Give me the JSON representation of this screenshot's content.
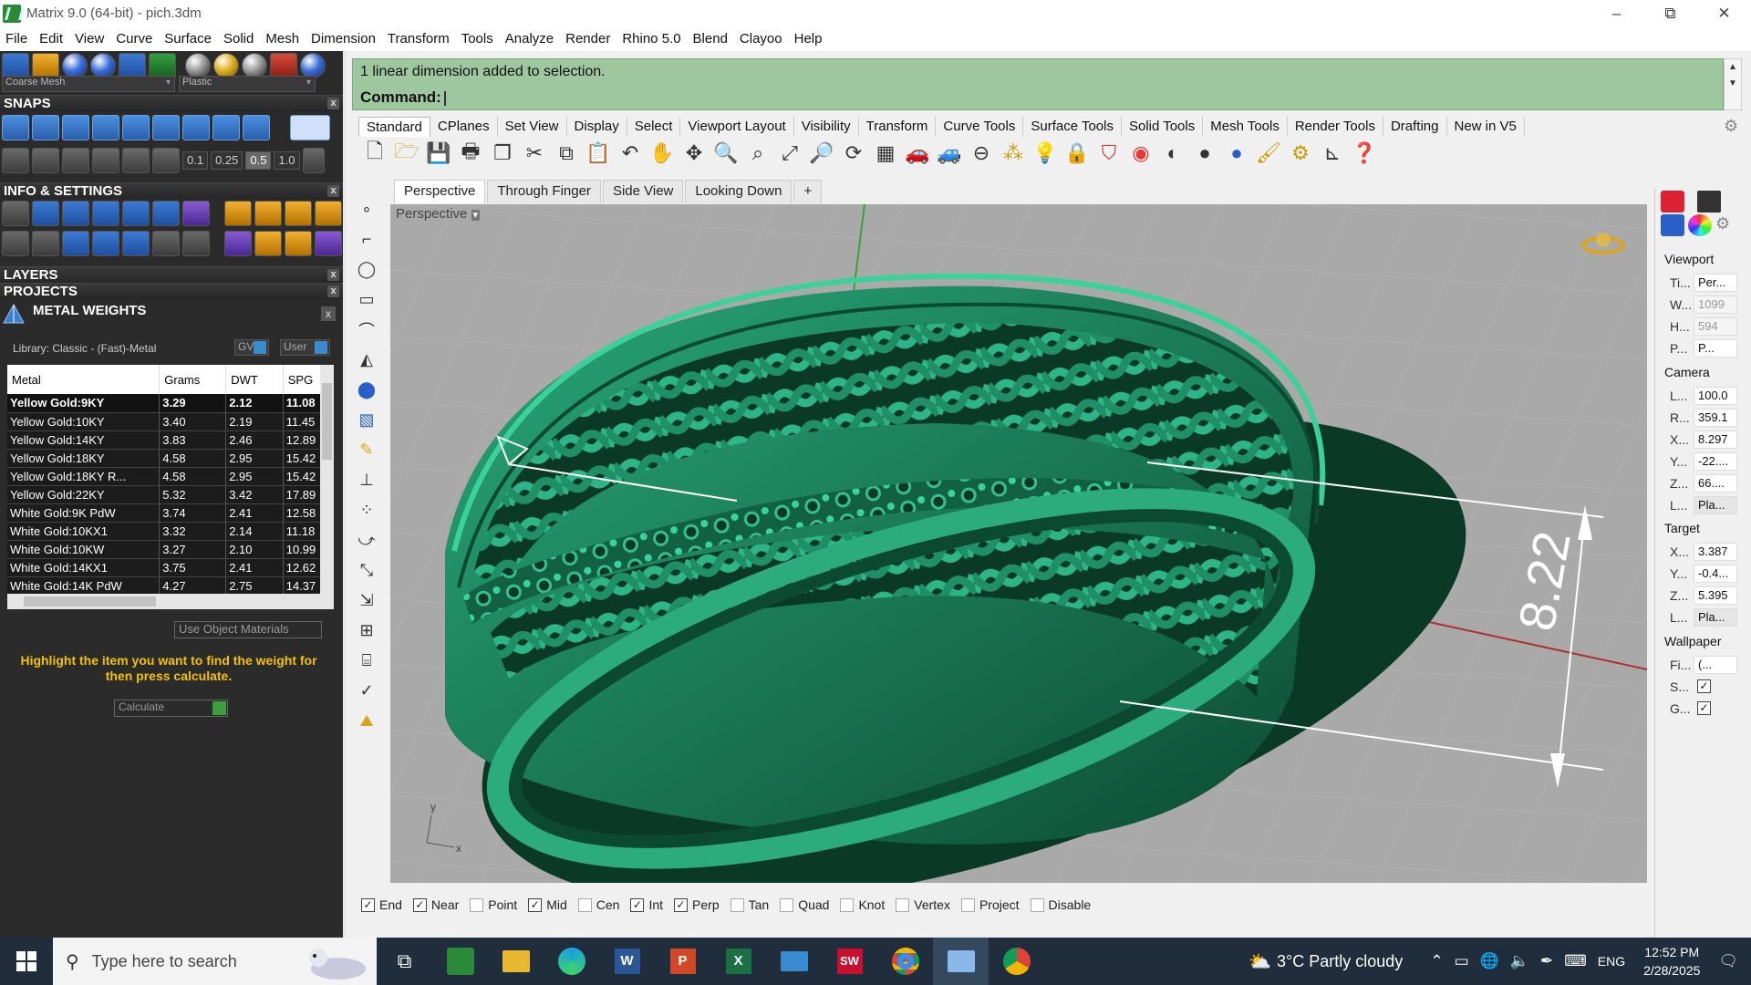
{
  "window": {
    "title": "Matrix 9.0 (64-bit) - pich.3dm"
  },
  "menu": [
    "File",
    "Edit",
    "View",
    "Curve",
    "Surface",
    "Solid",
    "Mesh",
    "Dimension",
    "Transform",
    "Tools",
    "Analyze",
    "Render",
    "Rhino 5.0",
    "Blend",
    "Clayoo",
    "Help"
  ],
  "left_panel": {
    "mesh_combo": "Coarse Mesh",
    "material_combo": "Plastic",
    "snaps_title": "SNAPS",
    "snap_values": [
      "0.1",
      "0.25",
      "0.5",
      "1.0"
    ],
    "info_title": "INFO & SETTINGS",
    "layers_title": "LAYERS",
    "projects_title": "PROJECTS",
    "metal_weights_title": "METAL WEIGHTS",
    "library": "Library: Classic - (Fast)-Metal",
    "gv": "GV",
    "user": "User",
    "columns": [
      "Metal",
      "Grams",
      "DWT",
      "SPG"
    ],
    "rows": [
      [
        "Yellow Gold:9KY",
        "3.29",
        "2.12",
        "11.08"
      ],
      [
        "Yellow Gold:10KY",
        "3.40",
        "2.19",
        "11.45"
      ],
      [
        "Yellow Gold:14KY",
        "3.83",
        "2.46",
        "12.89"
      ],
      [
        "Yellow Gold:18KY",
        "4.58",
        "2.95",
        "15.42"
      ],
      [
        "Yellow Gold:18KY R...",
        "4.58",
        "2.95",
        "15.42"
      ],
      [
        "Yellow Gold:22KY",
        "5.32",
        "3.42",
        "17.89"
      ],
      [
        "White Gold:9K PdW",
        "3.74",
        "2.41",
        "12.58"
      ],
      [
        "White Gold:10KX1",
        "3.32",
        "2.14",
        "11.18"
      ],
      [
        "White Gold:10KW",
        "3.27",
        "2.10",
        "10.99"
      ],
      [
        "White Gold:14KX1",
        "3.75",
        "2.41",
        "12.62"
      ],
      [
        "White Gold:14K PdW",
        "4.27",
        "2.75",
        "14.37"
      ]
    ],
    "use_object_materials": "Use Object Materials",
    "instruction": "Highlight the item you want to find the weight for then press calculate.",
    "calculate": "Calculate"
  },
  "command": {
    "history": "1 linear dimension added to selection.",
    "prompt": "Command:"
  },
  "toolbar_tabs": [
    "Standard",
    "CPlanes",
    "Set View",
    "Display",
    "Select",
    "Viewport Layout",
    "Visibility",
    "Transform",
    "Curve Tools",
    "Surface Tools",
    "Solid Tools",
    "Mesh Tools",
    "Render Tools",
    "Drafting",
    "New in V5"
  ],
  "viewport_tabs": [
    "Perspective",
    "Through Finger",
    "Side View",
    "Looking Down"
  ],
  "viewport": {
    "label": "Perspective",
    "dimension": "8.22",
    "axis_x": "x",
    "axis_y": "y",
    "accent": "#1e7a55"
  },
  "osnaps": [
    {
      "label": "End",
      "checked": true
    },
    {
      "label": "Near",
      "checked": true
    },
    {
      "label": "Point",
      "checked": false
    },
    {
      "label": "Mid",
      "checked": true
    },
    {
      "label": "Cen",
      "checked": false
    },
    {
      "label": "Int",
      "checked": true
    },
    {
      "label": "Perp",
      "checked": true
    },
    {
      "label": "Tan",
      "checked": false
    },
    {
      "label": "Quad",
      "checked": false
    },
    {
      "label": "Knot",
      "checked": false
    },
    {
      "label": "Vertex",
      "checked": false
    },
    {
      "label": "Project",
      "checked": false
    },
    {
      "label": "Disable",
      "checked": false
    }
  ],
  "properties": {
    "viewport_title": "Viewport",
    "viewport_rows": [
      [
        "Ti...",
        "Per..."
      ],
      [
        "W...",
        "1099"
      ],
      [
        "H...",
        "594"
      ],
      [
        "P...",
        "P..."
      ]
    ],
    "camera_title": "Camera",
    "camera_rows": [
      [
        "L...",
        "100.0"
      ],
      [
        "R...",
        "359.1"
      ],
      [
        "X...",
        "8.297"
      ],
      [
        "Y...",
        "-22...."
      ],
      [
        "Z...",
        "66...."
      ],
      [
        "L...",
        "Pla..."
      ]
    ],
    "target_title": "Target",
    "target_rows": [
      [
        "X...",
        "3.387"
      ],
      [
        "Y...",
        "-0.4..."
      ],
      [
        "Z...",
        "5.395"
      ],
      [
        "L...",
        "Pla..."
      ]
    ],
    "wallpaper_title": "Wallpaper",
    "wallpaper_rows": [
      [
        "Fi...",
        "(..."
      ],
      [
        "S...",
        ""
      ],
      [
        "G...",
        ""
      ]
    ]
  },
  "taskbar": {
    "search_placeholder": "Type here to search",
    "weather": "3°C  Partly cloudy",
    "language": "ENG",
    "time": "12:52 PM",
    "date": "2/28/2025"
  }
}
